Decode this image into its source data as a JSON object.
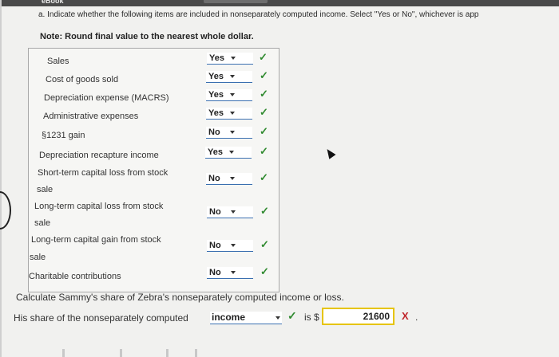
{
  "header": {
    "ebook_label": "eBook"
  },
  "instructions": "a. Indicate whether the following items are included in nonseparately computed income. Select \"Yes or No\", whichever is app",
  "note": "Note: Round final value to the nearest whole dollar.",
  "items": [
    {
      "label": "Sales",
      "value": "Yes"
    },
    {
      "label": "Cost of goods sold",
      "value": "Yes"
    },
    {
      "label": "Depreciation expense (MACRS)",
      "value": "Yes"
    },
    {
      "label": "Administrative expenses",
      "value": "Yes"
    },
    {
      "label": "§1231 gain",
      "value": "No"
    },
    {
      "label": "Depreciation recapture income",
      "value": "Yes"
    },
    {
      "label": "Short-term capital loss from stock",
      "label2": "sale",
      "value": "No"
    },
    {
      "label": "Long-term capital loss from stock",
      "label2": "sale",
      "value": "No"
    },
    {
      "label": "Long-term capital gain from stock",
      "label2": "sale",
      "value": "No"
    },
    {
      "label": "Charitable contributions",
      "value": "No"
    }
  ],
  "check_glyph": "✓",
  "calc_prompt": "Calculate Sammy's share of Zebra's nonseparately computed income or loss.",
  "share_prefix": "His share of the nonseparately computed",
  "share_select": "income",
  "is_label": "is $",
  "answer_value": "21600",
  "x_glyph": "X",
  "period": ".",
  "colors": {
    "correct": "#2f8a2f",
    "incorrect": "#c0262c",
    "answer_border": "#e6c400"
  }
}
